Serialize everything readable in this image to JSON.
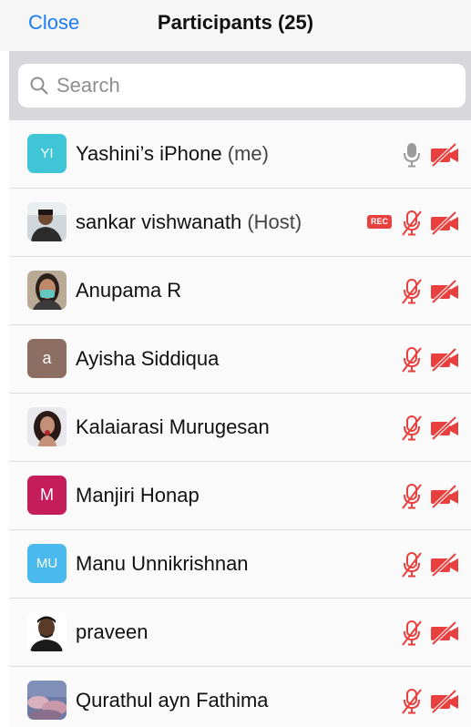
{
  "header": {
    "close_label": "Close",
    "title": "Participants (25)"
  },
  "search": {
    "placeholder": "Search",
    "value": ""
  },
  "colors": {
    "accent": "#1a7cf6",
    "muted_red": "#e8403e",
    "mic_gray": "#9b9b9b"
  },
  "rec_badge": "REC",
  "participants": [
    {
      "name": "Yashini’s iPhone",
      "tag": "(me)",
      "avatar_initials": "YI",
      "avatar_color": "#3fc5d6",
      "mic": "on",
      "video": "off"
    },
    {
      "name": "sankar vishwanath",
      "tag": "(Host)",
      "avatar_photo": "photo-avatar-1",
      "recording": true,
      "mic": "off",
      "video": "off"
    },
    {
      "name": "Anupama R",
      "tag": "",
      "avatar_photo": "photo-avatar-2",
      "mic": "off",
      "video": "off"
    },
    {
      "name": "Ayisha Siddiqua",
      "tag": "",
      "avatar_initials": "a",
      "avatar_color": "#8c6e62",
      "mic": "off",
      "video": "off"
    },
    {
      "name": "Kalaiarasi Murugesan",
      "tag": "",
      "avatar_photo": "photo-avatar-3",
      "mic": "off",
      "video": "off"
    },
    {
      "name": "Manjiri Honap",
      "tag": "",
      "avatar_initials": "M",
      "avatar_color": "#c51c5a",
      "mic": "off",
      "video": "off"
    },
    {
      "name": "Manu Unnikrishnan",
      "tag": "",
      "avatar_initials": "MU",
      "avatar_color": "#49b9ee",
      "mic": "off",
      "video": "off"
    },
    {
      "name": "praveen",
      "tag": "",
      "avatar_photo": "photo-avatar-4",
      "mic": "off",
      "video": "off"
    },
    {
      "name": "Qurathul ayn Fathima",
      "tag": "",
      "avatar_photo": "photo-avatar-5",
      "mic": "off",
      "video": "off"
    }
  ]
}
